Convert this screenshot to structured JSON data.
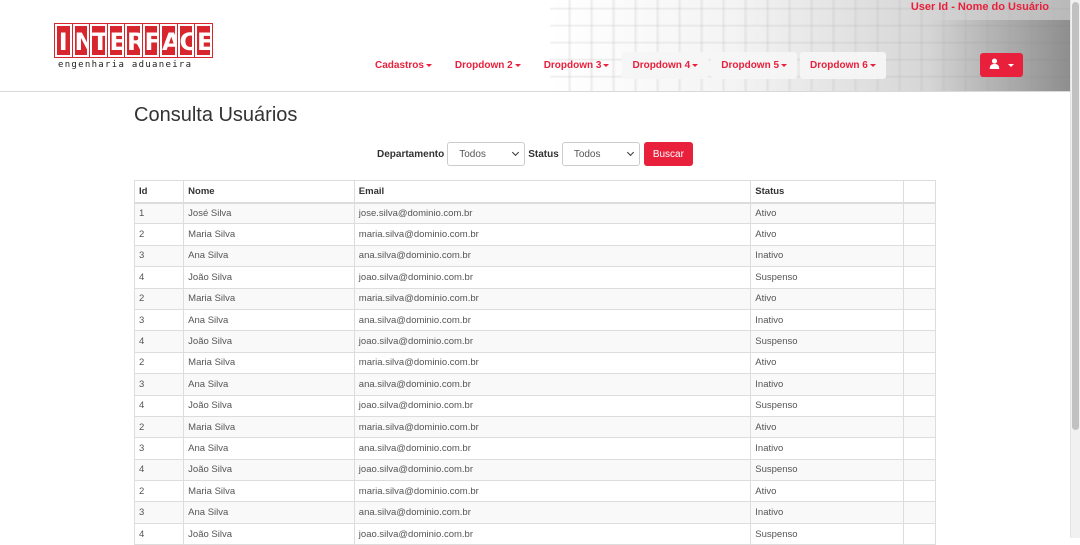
{
  "header": {
    "logo_text": "INTERFACE",
    "logo_subtitle": "engenharia  aduaneira",
    "user_label": "User Id - Nome do Usuário",
    "nav": [
      "Cadastros",
      "Dropdown 2",
      "Dropdown 3",
      "Dropdown 4",
      "Dropdown 5",
      "Dropdown 6"
    ],
    "user_menu_icon": "user-icon"
  },
  "page": {
    "title": "Consulta Usuários"
  },
  "filters": {
    "departamento_label": "Departamento",
    "departamento_value": "Todos",
    "status_label": "Status",
    "status_value": "Todos",
    "search_button": "Buscar"
  },
  "table": {
    "columns": [
      "Id",
      "Nome",
      "Email",
      "Status"
    ],
    "rows": [
      {
        "id": "1",
        "nome": "José Silva",
        "email": "jose.silva@dominio.com.br",
        "status": "Ativo"
      },
      {
        "id": "2",
        "nome": "Maria Silva",
        "email": "maria.silva@dominio.com.br",
        "status": "Ativo"
      },
      {
        "id": "3",
        "nome": "Ana Silva",
        "email": "ana.silva@dominio.com.br",
        "status": "Inativo"
      },
      {
        "id": "4",
        "nome": "João Silva",
        "email": "joao.silva@dominio.com.br",
        "status": "Suspenso"
      },
      {
        "id": "2",
        "nome": "Maria Silva",
        "email": "maria.silva@dominio.com.br",
        "status": "Ativo"
      },
      {
        "id": "3",
        "nome": "Ana Silva",
        "email": "ana.silva@dominio.com.br",
        "status": "Inativo"
      },
      {
        "id": "4",
        "nome": "João Silva",
        "email": "joao.silva@dominio.com.br",
        "status": "Suspenso"
      },
      {
        "id": "2",
        "nome": "Maria Silva",
        "email": "maria.silva@dominio.com.br",
        "status": "Ativo"
      },
      {
        "id": "3",
        "nome": "Ana Silva",
        "email": "ana.silva@dominio.com.br",
        "status": "Inativo"
      },
      {
        "id": "4",
        "nome": "João Silva",
        "email": "joao.silva@dominio.com.br",
        "status": "Suspenso"
      },
      {
        "id": "2",
        "nome": "Maria Silva",
        "email": "maria.silva@dominio.com.br",
        "status": "Ativo"
      },
      {
        "id": "3",
        "nome": "Ana Silva",
        "email": "ana.silva@dominio.com.br",
        "status": "Inativo"
      },
      {
        "id": "4",
        "nome": "João Silva",
        "email": "joao.silva@dominio.com.br",
        "status": "Suspenso"
      },
      {
        "id": "2",
        "nome": "Maria Silva",
        "email": "maria.silva@dominio.com.br",
        "status": "Ativo"
      },
      {
        "id": "3",
        "nome": "Ana Silva",
        "email": "ana.silva@dominio.com.br",
        "status": "Inativo"
      },
      {
        "id": "4",
        "nome": "João Silva",
        "email": "joao.silva@dominio.com.br",
        "status": "Suspenso"
      }
    ]
  },
  "colors": {
    "brand_red": "#e8203c",
    "logo_red": "#d7262e"
  }
}
